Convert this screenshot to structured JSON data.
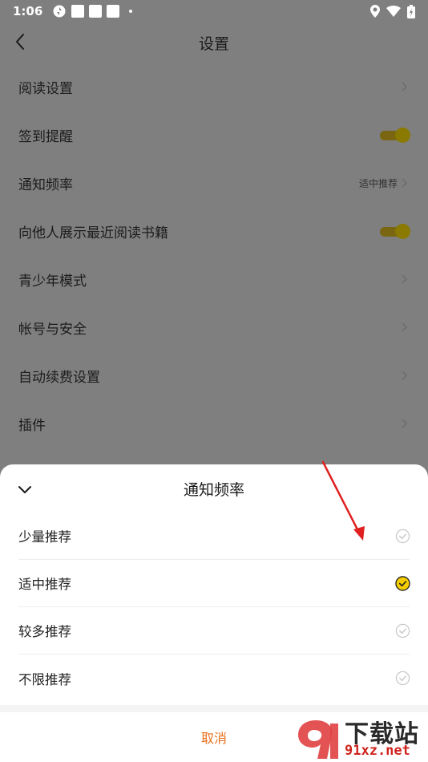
{
  "status_bar": {
    "time": "1:06"
  },
  "header": {
    "title": "设置"
  },
  "settings": {
    "items": [
      {
        "label": "阅读设置"
      },
      {
        "label": "签到提醒"
      },
      {
        "label": "通知频率",
        "value": "适中推荐"
      },
      {
        "label": "向他人展示最近阅读书籍"
      },
      {
        "label": "青少年模式"
      },
      {
        "label": "帐号与安全"
      },
      {
        "label": "自动续费设置"
      },
      {
        "label": "插件"
      }
    ],
    "toggles": {
      "sign_in_reminder": true,
      "show_recent_books": true
    }
  },
  "sheet": {
    "title": "通知频率",
    "options": [
      {
        "label": "少量推荐",
        "selected": false
      },
      {
        "label": "适中推荐",
        "selected": true
      },
      {
        "label": "较多推荐",
        "selected": false
      },
      {
        "label": "不限推荐",
        "selected": false
      }
    ],
    "cancel_label": "取消"
  },
  "watermark": {
    "text_top": "下载站",
    "text_bottom": "91xz.net"
  },
  "colors": {
    "accent": "#f5cd00",
    "cancel": "#e8701a",
    "overlay": "#7f7f7f",
    "arrow": "#e02020"
  }
}
